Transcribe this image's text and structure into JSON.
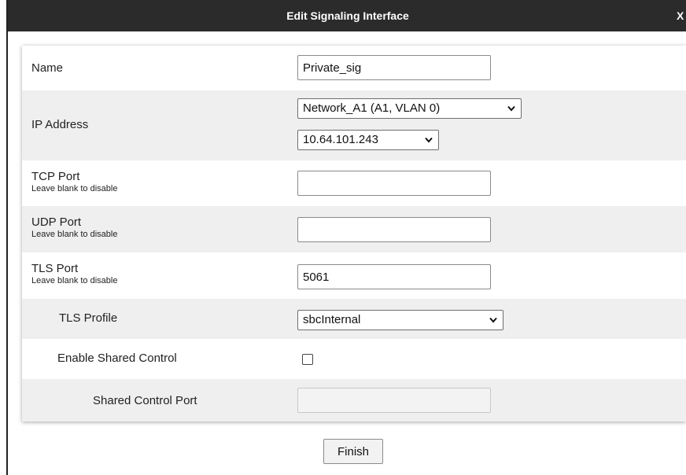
{
  "dialog": {
    "title": "Edit Signaling Interface",
    "close_label": "X",
    "finish_label": "Finish"
  },
  "fields": {
    "name": {
      "label": "Name",
      "value": "Private_sig"
    },
    "ip_address": {
      "label": "IP Address",
      "network_value": "Network_A1 (A1, VLAN 0)",
      "ip_value": "10.64.101.243"
    },
    "tcp_port": {
      "label": "TCP Port",
      "hint": "Leave blank to disable",
      "value": ""
    },
    "udp_port": {
      "label": "UDP Port",
      "hint": "Leave blank to disable",
      "value": ""
    },
    "tls_port": {
      "label": "TLS Port",
      "hint": "Leave blank to disable",
      "value": "5061"
    },
    "tls_profile": {
      "label": "TLS Profile",
      "value": "sbcInternal"
    },
    "enable_shared_control": {
      "label": "Enable Shared Control",
      "checked": false
    },
    "shared_control_port": {
      "label": "Shared Control Port",
      "value": ""
    }
  }
}
